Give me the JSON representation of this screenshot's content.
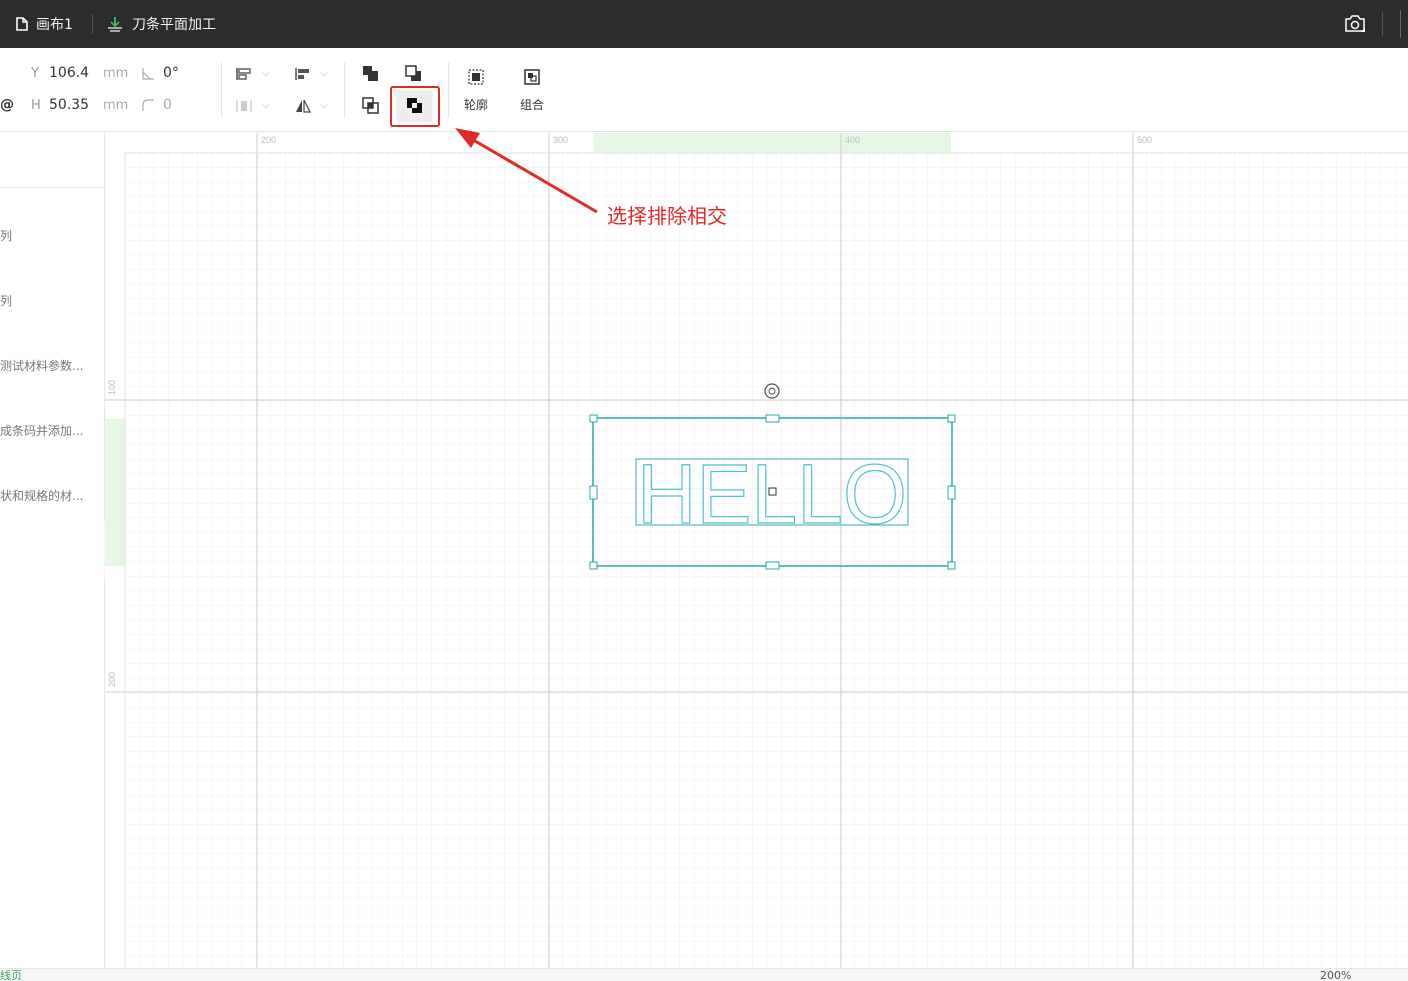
{
  "tabs": [
    {
      "label": "画布1",
      "icon": "document-icon"
    },
    {
      "label": "刀条平面加工",
      "icon": "blade-icon"
    }
  ],
  "toolbar": {
    "y_label": "Y",
    "y_value": "106.4",
    "h_label": "H",
    "h_value": "50.35",
    "unit": "mm",
    "angle_value": "0°",
    "radius_value": "0",
    "lock_char": "@",
    "outline_label": "轮廓",
    "group_label": "组合"
  },
  "left_panel": {
    "items": [
      "列",
      "列",
      "测试材料参数...",
      "成条码并添加...",
      "状和规格的材..."
    ]
  },
  "rulers": {
    "top": [
      "200",
      "300",
      "400",
      "500"
    ],
    "left": [
      "100",
      "200"
    ]
  },
  "canvas": {
    "text": "HELLO",
    "selection_color": "#2aa8a8",
    "text_color": "#4ec0d8",
    "highlight_color": "#e6f7e6"
  },
  "annotation": {
    "text": "选择排除相交",
    "color": "#e12a25"
  },
  "statusbar": {
    "left_text": "线页",
    "right_text": "200%"
  }
}
